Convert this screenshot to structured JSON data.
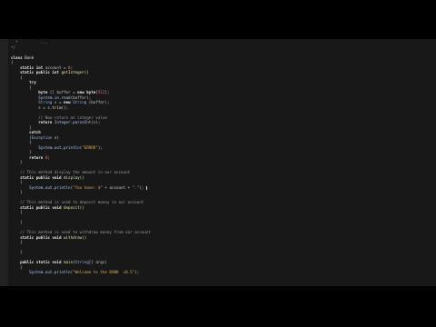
{
  "editor": {
    "lines": [
      [
        {
          "t": "  ",
          "c": ""
        },
        {
          "t": "*",
          "c": "cm"
        },
        {
          "t": "          ",
          "c": ""
        },
        {
          "t": "...",
          "c": "cm"
        }
      ],
      [
        {
          "t": "*/",
          "c": "cm"
        }
      ],
      [
        {
          "t": "",
          "c": ""
        }
      ],
      [
        {
          "t": "class ",
          "c": "kw"
        },
        {
          "t": "Bank",
          "c": "fn"
        }
      ],
      [
        {
          "t": "{",
          "c": ""
        }
      ],
      [
        {
          "t": "    ",
          "c": ""
        },
        {
          "t": "static int ",
          "c": "kw"
        },
        {
          "t": "account = ",
          "c": ""
        },
        {
          "t": "0",
          "c": "num"
        },
        {
          "t": ";",
          "c": ""
        }
      ],
      [
        {
          "t": "    ",
          "c": ""
        },
        {
          "t": "static public int ",
          "c": "kw"
        },
        {
          "t": "getInteger()",
          "c": "fn"
        }
      ],
      [
        {
          "t": "    {",
          "c": ""
        }
      ],
      [
        {
          "t": "        ",
          "c": ""
        },
        {
          "t": "try",
          "c": "kw"
        }
      ],
      [
        {
          "t": "        {",
          "c": ""
        }
      ],
      [
        {
          "t": "            ",
          "c": ""
        },
        {
          "t": "byte",
          "c": "kw"
        },
        {
          "t": " [] buffer = ",
          "c": ""
        },
        {
          "t": "new ",
          "c": "kw"
        },
        {
          "t": "byte",
          "c": "kw"
        },
        {
          "t": "[",
          "c": ""
        },
        {
          "t": "512",
          "c": "num"
        },
        {
          "t": "];",
          "c": ""
        }
      ],
      [
        {
          "t": "            ",
          "c": ""
        },
        {
          "t": "System.in.read",
          "c": "sys"
        },
        {
          "t": "(buffer);",
          "c": ""
        }
      ],
      [
        {
          "t": "            ",
          "c": ""
        },
        {
          "t": "String",
          "c": "typ"
        },
        {
          "t": " s = ",
          "c": ""
        },
        {
          "t": "new ",
          "c": "kw"
        },
        {
          "t": "String",
          "c": "typ"
        },
        {
          "t": " (buffer);",
          "c": ""
        }
      ],
      [
        {
          "t": "            s = s.",
          "c": ""
        },
        {
          "t": "trim",
          "c": "fn"
        },
        {
          "t": "();",
          "c": ""
        }
      ],
      [
        {
          "t": "",
          "c": ""
        }
      ],
      [
        {
          "t": "            ",
          "c": ""
        },
        {
          "t": "// Now return an integer value",
          "c": "cm"
        }
      ],
      [
        {
          "t": "            ",
          "c": ""
        },
        {
          "t": "return ",
          "c": "kw"
        },
        {
          "t": "Integer.parseInt",
          "c": "sys"
        },
        {
          "t": "(s);",
          "c": ""
        }
      ],
      [
        {
          "t": "        }",
          "c": ""
        }
      ],
      [
        {
          "t": "        ",
          "c": ""
        },
        {
          "t": "catch",
          "c": "kw"
        }
      ],
      [
        {
          "t": "        (",
          "c": ""
        },
        {
          "t": "Exception",
          "c": "typ"
        },
        {
          "t": " e)",
          "c": ""
        }
      ],
      [
        {
          "t": "        {",
          "c": ""
        }
      ],
      [
        {
          "t": "            ",
          "c": ""
        },
        {
          "t": "System.out.println",
          "c": "sys"
        },
        {
          "t": "(",
          "c": ""
        },
        {
          "t": "\"ERROR\"",
          "c": "str"
        },
        {
          "t": ");",
          "c": ""
        }
      ],
      [
        {
          "t": "        }",
          "c": ""
        }
      ],
      [
        {
          "t": "        ",
          "c": ""
        },
        {
          "t": "return ",
          "c": "kw"
        },
        {
          "t": "0",
          "c": "num"
        },
        {
          "t": ";",
          "c": ""
        }
      ],
      [
        {
          "t": "    }",
          "c": ""
        }
      ],
      [
        {
          "t": "",
          "c": ""
        }
      ],
      [
        {
          "t": "    ",
          "c": ""
        },
        {
          "t": "// This method display the amount in our account",
          "c": "cm"
        }
      ],
      [
        {
          "t": "    ",
          "c": ""
        },
        {
          "t": "static public void ",
          "c": "kw"
        },
        {
          "t": "display()",
          "c": "fn"
        }
      ],
      [
        {
          "t": "    {",
          "c": ""
        }
      ],
      [
        {
          "t": "        ",
          "c": ""
        },
        {
          "t": "System.out.println",
          "c": "sys"
        },
        {
          "t": "(",
          "c": ""
        },
        {
          "t": "\"You have: $\"",
          "c": "str"
        },
        {
          "t": " + account + ",
          "c": ""
        },
        {
          "t": "\".\"",
          "c": "str"
        },
        {
          "t": "); ",
          "c": ""
        },
        {
          "t": "|",
          "c": "cursor"
        }
      ],
      [
        {
          "t": "    }",
          "c": ""
        }
      ],
      [
        {
          "t": "",
          "c": ""
        }
      ],
      [
        {
          "t": "    ",
          "c": ""
        },
        {
          "t": "// This method is used to deposit money in our account",
          "c": "cm"
        }
      ],
      [
        {
          "t": "    ",
          "c": ""
        },
        {
          "t": "static public void ",
          "c": "kw"
        },
        {
          "t": "deposit()",
          "c": "fn"
        }
      ],
      [
        {
          "t": "    {",
          "c": ""
        }
      ],
      [
        {
          "t": "",
          "c": ""
        }
      ],
      [
        {
          "t": "    }",
          "c": ""
        }
      ],
      [
        {
          "t": "",
          "c": ""
        }
      ],
      [
        {
          "t": "    ",
          "c": ""
        },
        {
          "t": "// This method is used to withdraw money from our account",
          "c": "cm"
        }
      ],
      [
        {
          "t": "    ",
          "c": ""
        },
        {
          "t": "static public void ",
          "c": "kw"
        },
        {
          "t": "withdraw()",
          "c": "fn"
        }
      ],
      [
        {
          "t": "    {",
          "c": ""
        }
      ],
      [
        {
          "t": "",
          "c": ""
        }
      ],
      [
        {
          "t": "    }",
          "c": ""
        }
      ],
      [
        {
          "t": "",
          "c": ""
        }
      ],
      [
        {
          "t": "    ",
          "c": ""
        },
        {
          "t": "public static void ",
          "c": "kw"
        },
        {
          "t": "main(",
          "c": "fn"
        },
        {
          "t": "String",
          "c": "typ"
        },
        {
          "t": "[] args)",
          "c": ""
        }
      ],
      [
        {
          "t": "    {",
          "c": ""
        }
      ],
      [
        {
          "t": "        ",
          "c": ""
        },
        {
          "t": "System.out.println",
          "c": "sys"
        },
        {
          "t": "(",
          "c": ""
        },
        {
          "t": "\"Welcome to the BANK  v0.5\"",
          "c": "str"
        },
        {
          "t": ");",
          "c": ""
        }
      ],
      [
        {
          "t": "",
          "c": ""
        }
      ]
    ]
  }
}
